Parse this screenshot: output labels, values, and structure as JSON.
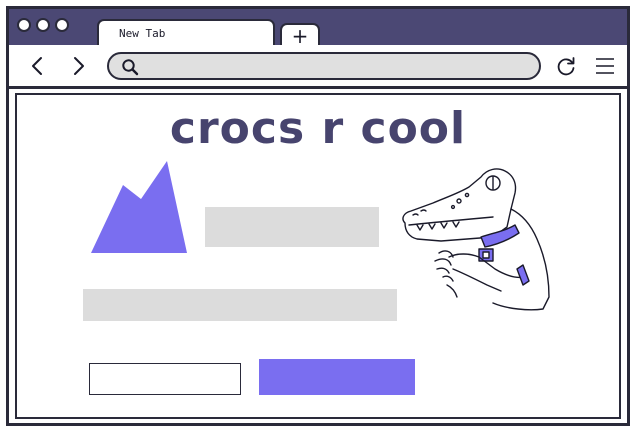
{
  "browser": {
    "tab_title": "New Tab",
    "new_tab_symbol": "+",
    "address_value": "",
    "colors": {
      "frame": "#4b4874",
      "accent": "#7a6ef0",
      "placeholder": "#dcdcdc"
    }
  },
  "toolbar_icons": [
    "back-arrow-icon",
    "forward-arrow-icon",
    "search-icon",
    "reload-icon",
    "menu-icon"
  ],
  "page": {
    "headline": "crocs r cool",
    "illustration": "crocodile-mascot"
  }
}
